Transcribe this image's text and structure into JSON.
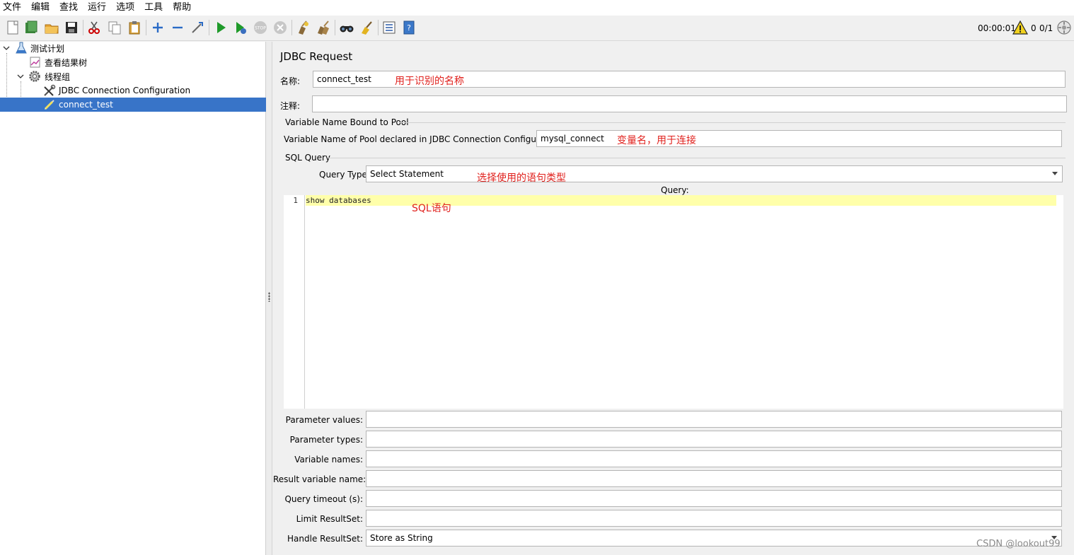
{
  "menu": [
    "文件",
    "编辑",
    "查找",
    "运行",
    "选项",
    "工具",
    "帮助"
  ],
  "toolbar": {
    "icons": [
      "new-icon",
      "templates-icon",
      "open-icon",
      "save-icon",
      "cut-icon",
      "copy-icon",
      "paste-icon",
      "expand-icon",
      "collapse-icon",
      "toggle-icon",
      "start-icon",
      "start-no-pause-icon",
      "stop-icon",
      "shutdown-icon",
      "clear-icon",
      "clear-all-icon",
      "search-icon",
      "reset-search-icon",
      "function-helper-icon",
      "help-icon"
    ],
    "timer": "00:00:01",
    "warning_count": "0",
    "threads": "0/1"
  },
  "tree": {
    "items": [
      {
        "label": "测试计划",
        "icon": "test-plan-icon",
        "level": 0,
        "expanded": true
      },
      {
        "label": "查看结果树",
        "icon": "listener-icon",
        "level": 1
      },
      {
        "label": "线程组",
        "icon": "thread-group-gear-icon",
        "level": 1,
        "expanded": true
      },
      {
        "label": "JDBC Connection Configuration",
        "icon": "config-tools-icon",
        "level": 2
      },
      {
        "label": "connect_test",
        "icon": "sampler-pen-icon",
        "level": 2,
        "selected": true
      }
    ]
  },
  "panel": {
    "title": "JDBC Request",
    "name_label": "名称:",
    "name_value": "connect_test",
    "name_annotation": "用于识别的名称",
    "comment_label": "注释:",
    "comment_value": "",
    "pool_section": "Variable Name Bound to Pool",
    "pool_label": "Variable Name of Pool declared in JDBC Connection Configuration:",
    "pool_value": "mysql_connect",
    "pool_annotation": "变量名，用于连接",
    "sql_section": "SQL Query",
    "query_type_label": "Query Type:",
    "query_type_value": "Select Statement",
    "query_type_annotation": "选择使用的语句类型",
    "query_label": "Query:",
    "query_line_number": "1",
    "query_text": "show databases",
    "query_annotation": "SQL语句",
    "params": [
      {
        "label": "Parameter values:",
        "value": ""
      },
      {
        "label": "Parameter types:",
        "value": ""
      },
      {
        "label": "Variable names:",
        "value": ""
      },
      {
        "label": "Result variable name:",
        "value": ""
      },
      {
        "label": "Query timeout (s):",
        "value": ""
      },
      {
        "label": "Limit ResultSet:",
        "value": ""
      },
      {
        "label": "Handle ResultSet:",
        "value": "Store as String"
      }
    ]
  },
  "watermark": "CSDN @lookout99",
  "colors": {
    "selection": "#3874c8",
    "annotation": "#e0201c",
    "highlight_line": "#ffffaa"
  }
}
